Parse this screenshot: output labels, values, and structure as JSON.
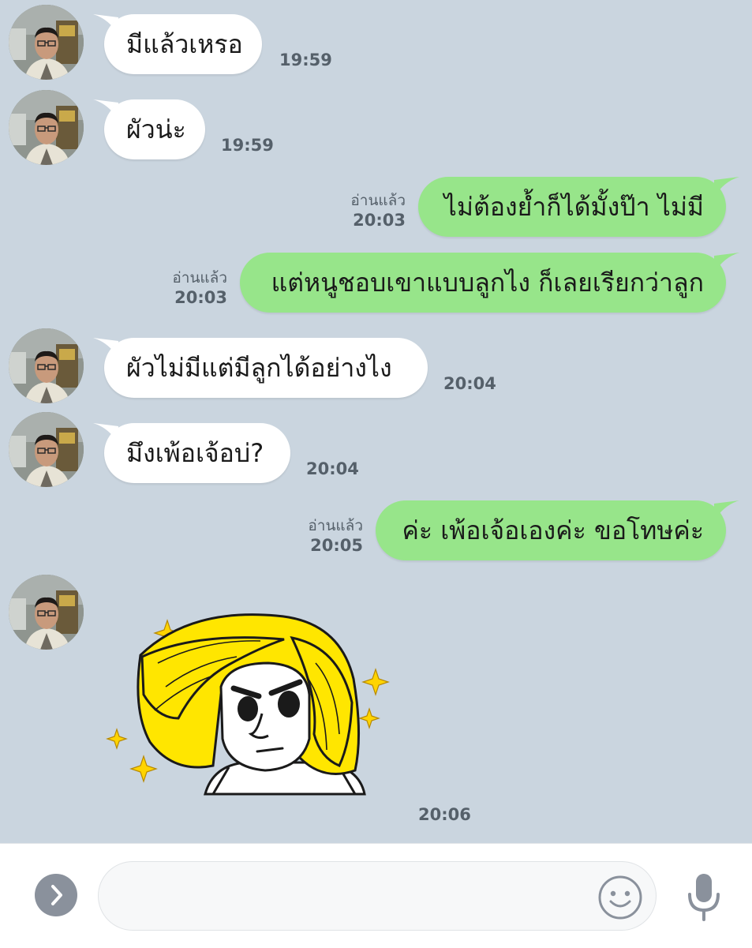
{
  "conversation": {
    "messages": [
      {
        "side": "in",
        "text": "มีแล้วเหรอ",
        "time": "19:59"
      },
      {
        "side": "in",
        "text": "ผัวน่ะ",
        "time": "19:59"
      },
      {
        "side": "out",
        "text": "ไม่ต้องย้ำก็ได้มั้งป๊า ไม่มี",
        "status": "อ่านแล้ว",
        "time": "20:03"
      },
      {
        "side": "out",
        "text": "แต่หนูชอบเขาแบบลูกไง ก็เลยเรียกว่าลูก",
        "status": "อ่านแล้ว",
        "time": "20:03"
      },
      {
        "side": "in",
        "text": "ผัวไม่มีแต่มีลูกได้อย่างไง",
        "time": "20:04"
      },
      {
        "side": "in",
        "text": "มึงเพ้อเจ้อบ่?",
        "time": "20:04"
      },
      {
        "side": "out",
        "text": "ค่ะ เพ้อเจ้อเองค่ะ ขอโทษค่ะ",
        "status": "อ่านแล้ว",
        "time": "20:05"
      },
      {
        "side": "in",
        "type": "sticker",
        "sticker": "blonde-hair-sticker",
        "time": "20:06"
      }
    ]
  },
  "input_bar": {
    "placeholder": "",
    "expand_icon": "chevron-right-icon",
    "emoji_icon": "emoji-icon",
    "mic_icon": "microphone-icon"
  },
  "colors": {
    "chat_background": "#cad5df",
    "outgoing_bubble": "#97e58a",
    "incoming_bubble": "#ffffff",
    "timestamp_text": "#55606a",
    "sticker_hair": "#ffe600"
  }
}
